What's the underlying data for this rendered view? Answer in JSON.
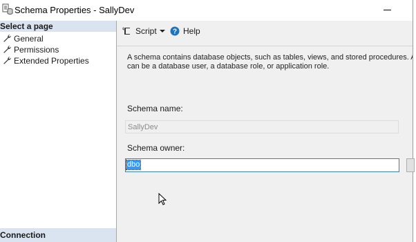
{
  "window": {
    "title": "Schema Properties - SallyDev",
    "icon": "database-properties-icon"
  },
  "sidebar": {
    "header": "Select a page",
    "items": [
      {
        "label": "General",
        "icon": "wrench-icon"
      },
      {
        "label": "Permissions",
        "icon": "wrench-icon"
      },
      {
        "label": "Extended Properties",
        "icon": "wrench-icon"
      }
    ],
    "connection_header": "Connection"
  },
  "toolbar": {
    "script_label": "Script",
    "help_label": "Help"
  },
  "main": {
    "description_line1": "A schema contains database objects, such as tables, views, and stored procedures. A sc",
    "description_line2": "can be a database user, a database role, or application role.",
    "schema_name_label": "Schema name:",
    "schema_name_value": "SallyDev",
    "schema_owner_label": "Schema owner:",
    "schema_owner_value": "dbo"
  },
  "colors": {
    "sidebar_header_bg": "#dae3f0",
    "main_bg": "#f0f0f0",
    "selection": "#3399ff",
    "focus_border": "#3c7fb1"
  }
}
